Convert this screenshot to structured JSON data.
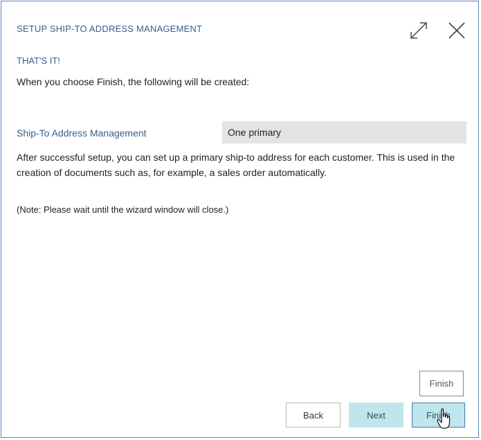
{
  "dialog": {
    "title": "SETUP SHIP-TO ADDRESS MANAGEMENT",
    "expand_icon": "expand-icon",
    "close_icon": "close-icon"
  },
  "content": {
    "subheading": "THAT'S IT!",
    "intro": "When you choose Finish, the following will be created:",
    "field": {
      "label": "Ship-To Address Management",
      "value": "One primary"
    },
    "description": "After successful setup, you can set up a primary ship-to address for each customer. This is used in the creation of documents such as, for example, a sales order automatically.",
    "note": "(Note: Please wait until the wizard window will close.)"
  },
  "tooltip": {
    "text": "Finish"
  },
  "buttons": {
    "back": "Back",
    "next": "Next",
    "finish": "Finish"
  },
  "colors": {
    "accent_text": "#355f8c",
    "border": "#5b83b7",
    "field_background": "#e3e3e3",
    "button_highlight": "#bfe6ec"
  }
}
